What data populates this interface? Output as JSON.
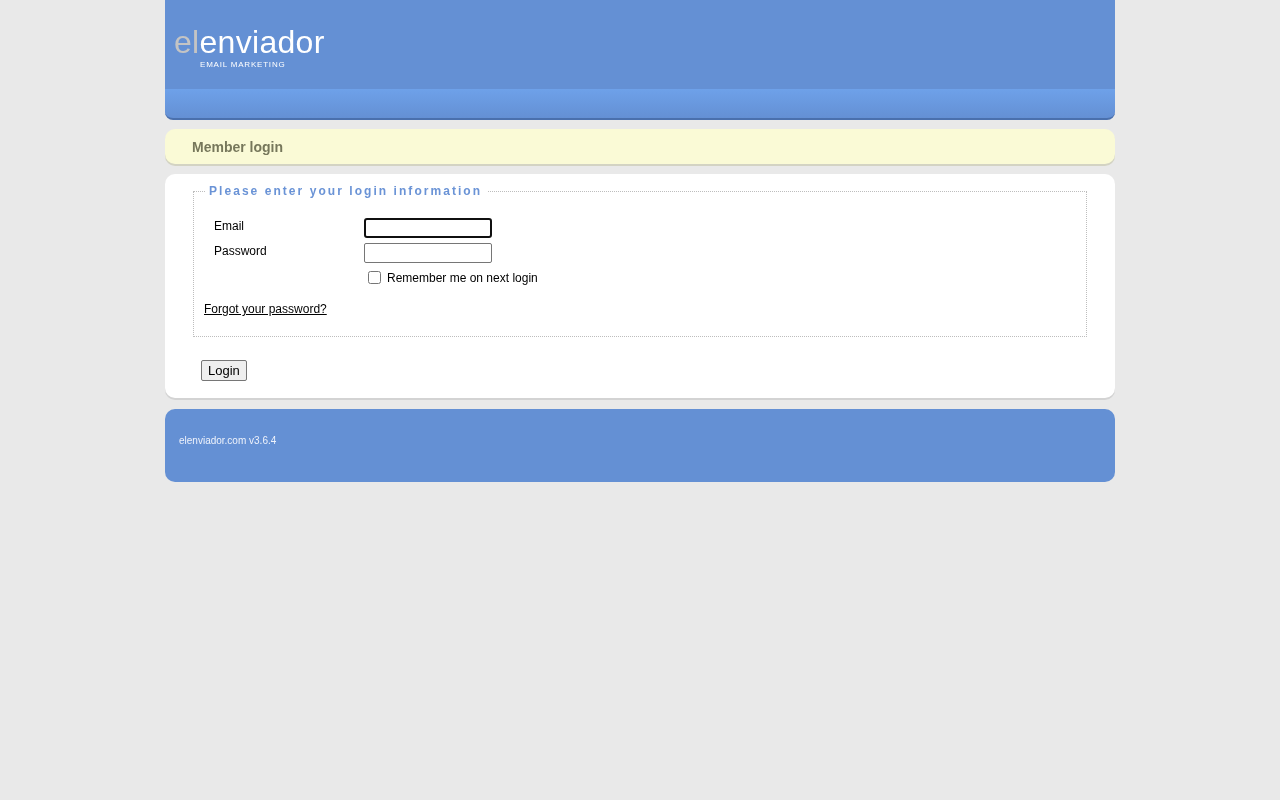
{
  "header": {
    "logo": {
      "prefix": "el",
      "name": "enviador",
      "tagline": "EMAIL MARKETING"
    }
  },
  "page_title": "Member login",
  "login_form": {
    "legend": "Please enter your login information",
    "fields": [
      {
        "label": "Email",
        "focused": true
      },
      {
        "label": "Password",
        "focused": false
      }
    ],
    "remember": {
      "label": "Remember me on next login",
      "checked": false
    },
    "forgot_link": "Forgot your password?",
    "submit": "Login"
  },
  "footer": {
    "version": "elenviador.com v3.6.4"
  }
}
